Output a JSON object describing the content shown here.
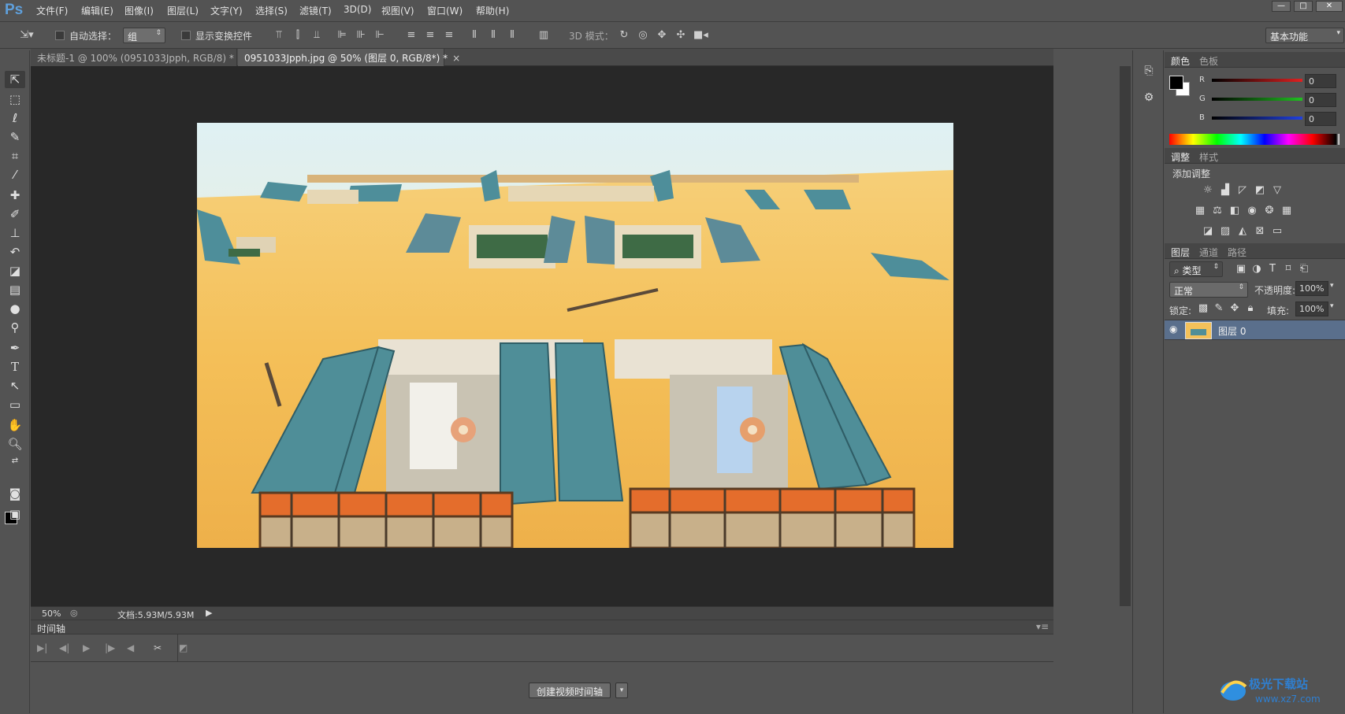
{
  "app": {
    "logo": "Ps"
  },
  "menu": [
    "文件(F)",
    "编辑(E)",
    "图像(I)",
    "图层(L)",
    "文字(Y)",
    "选择(S)",
    "滤镜(T)",
    "3D(D)",
    "视图(V)",
    "窗口(W)",
    "帮助(H)"
  ],
  "window_controls": {
    "minimize": "—",
    "maximize": "□",
    "close": "✕"
  },
  "options": {
    "auto_select_label": "自动选择：",
    "auto_select_value": "组",
    "show_transform_label": "显示变换控件",
    "mode_3d_label": "3D 模式：",
    "workspace": "基本功能"
  },
  "tabs": [
    {
      "label": "未标题-1 @ 100% (0951033Jpph, RGB/8) *",
      "active": false
    },
    {
      "label": "0951033Jpph.jpg @ 50% (图层 0, RGB/8*) *",
      "active": true
    }
  ],
  "status": {
    "zoom": "50%",
    "doc_label": "文档:5.93M/5.93M"
  },
  "timeline": {
    "title": "时间轴",
    "create_button": "创建视频时间轴"
  },
  "color_panel": {
    "tabs": [
      "颜色",
      "色板"
    ],
    "channels": [
      {
        "name": "R",
        "value": "0",
        "color": "#e02020"
      },
      {
        "name": "G",
        "value": "0",
        "color": "#20c020"
      },
      {
        "name": "B",
        "value": "0",
        "color": "#2040e0"
      }
    ]
  },
  "adjustments_panel": {
    "tabs": [
      "调整",
      "样式"
    ],
    "title": "添加调整"
  },
  "layers_panel": {
    "tabs": [
      "图层",
      "通道",
      "路径"
    ],
    "filter_kind": "类型",
    "blend_mode": "正常",
    "opacity_label": "不透明度:",
    "opacity_value": "100%",
    "lock_label": "锁定:",
    "fill_label": "填充:",
    "fill_value": "100%",
    "layers": [
      {
        "name": "图层 0",
        "visible": true
      }
    ]
  },
  "colors": {
    "accent": "#5fa0dc",
    "selected_layer": "#5a6f8c",
    "canvas_bg": "#282828"
  }
}
